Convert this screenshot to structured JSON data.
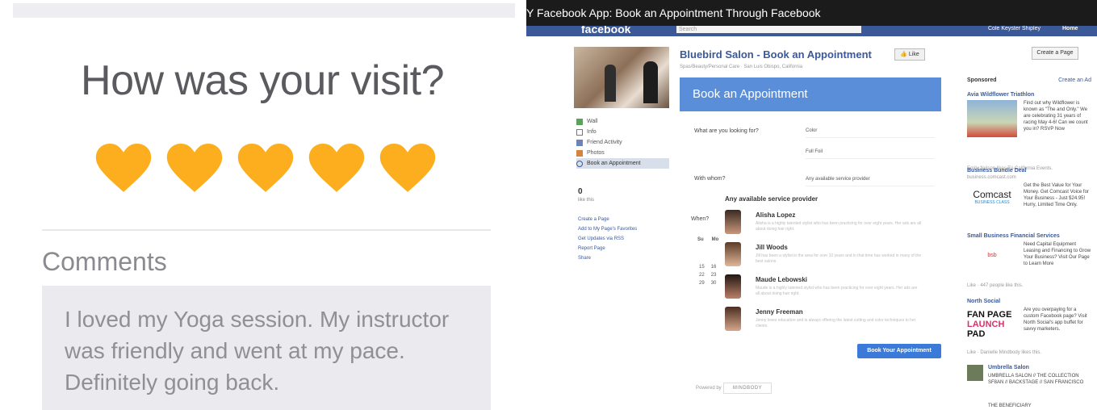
{
  "review": {
    "title": "How was your visit?",
    "rating": 5,
    "rating_max": 5,
    "heart_color": "#fcae1e",
    "comments_label": "Comments",
    "comment_text": "I loved my Yoga session. My instructor was friendly and went at my pace. Definitely going back."
  },
  "video": {
    "title": "Y Facebook App: Book an Appointment Through Facebook"
  },
  "fb": {
    "logo": "facebook",
    "search_placeholder": "Search",
    "user_name": "Cole Keyster Shipley",
    "home_label": "Home",
    "brand_color": "#3b5998"
  },
  "page": {
    "heading": "Bluebird Salon - Book an Appointment",
    "like_label": "Like",
    "subcategory": "Spas/Beauty/Personal Care · San Luis Obispo, California",
    "create_page_label": "Create a Page",
    "nav": [
      {
        "label": "Wall",
        "icon": "wall-icon"
      },
      {
        "label": "Info",
        "icon": "info-icon"
      },
      {
        "label": "Friend Activity",
        "icon": "friends-icon"
      },
      {
        "label": "Photos",
        "icon": "photos-icon"
      },
      {
        "label": "Book an Appointment",
        "icon": "calendar-icon"
      }
    ],
    "likes_count": "0",
    "likes_label": "like this",
    "links": [
      "Create a Page",
      "Add to My Page's Favorites",
      "Get Updates via RSS",
      "Report Page",
      "Share"
    ]
  },
  "booking": {
    "header": "Book an Appointment",
    "what_label": "What are you looking for?",
    "what_value_1": "Color",
    "what_value_2": "Full Foil",
    "with_label": "With whom?",
    "with_value": "Any available service provider",
    "any_provider_title": "Any available service provider",
    "when_label": "When?",
    "cal_days": [
      "Su",
      "Mo"
    ],
    "cal_rows": [
      [
        "15",
        "16"
      ],
      [
        "22",
        "23"
      ],
      [
        "29",
        "30"
      ]
    ],
    "providers": [
      {
        "name": "Alisha Lopez",
        "desc": "Alisha is a highly talented stylist who has been practicing for over eight years. Her ads are all about doing hair right."
      },
      {
        "name": "Jill Woods",
        "desc": "Jill has been a stylist in the area for over 10 years and in that time has worked in many of the best salons."
      },
      {
        "name": "Maude Lebowski",
        "desc": "Maude is a highly talented stylist who has been practicing for over eight years. Her ads are all about doing hair right."
      },
      {
        "name": "Jenny Freeman",
        "desc": "Jenny loves education and is always offering the latest cutting and color techniques to her clients."
      }
    ],
    "book_button": "Book Your Appointment",
    "powered_by": "Powered by",
    "powered_logo": "MINDBODY"
  },
  "sponsored": {
    "header": "Sponsored",
    "create_ad": "Create an Ad",
    "ads": [
      {
        "title": "Avia Wildflower Triathlon",
        "body": "Find out why Wildflower is known as \"The and Only.\" We are celebrating 31 years of racing May 4-6! Can we count you in? RSVP Now",
        "footer": "Emily Nelson likes Tri-California Events."
      },
      {
        "title": "Business Bundle Deal",
        "subtitle": "business.comcast.com",
        "body": "Get the Best Value for Your Money. Get Comcast Voice for Your Business - Just $24.95! Hurry, Limited Time Only.",
        "logo": "Comcast",
        "logo_sub": "BUSINESS CLASS"
      },
      {
        "title": "Small Business Financial Services",
        "body": "Need Capital Equipment Leasing and Financing to Grow Your Business? Visit Our Page to Learn More",
        "logo": "bsb",
        "footer": "Like · 447 people like this."
      },
      {
        "title": "North Social",
        "body": "Are you overpaying for a custom Facebook page? Visit North Social's app buffet for savvy marketers.",
        "logo_lines": [
          "FAN PAGE",
          "LAUNCH",
          "PAD"
        ],
        "footer": "Like · Danielle Mindbody likes this."
      },
      {
        "title": "Umbrella Salon",
        "body": "UMBRELLA SALON // THE COLLECTION SF8AN // BACKSTAGE // SAN FRANCISCO",
        "extra": "THE BENEFICIARY"
      }
    ]
  }
}
